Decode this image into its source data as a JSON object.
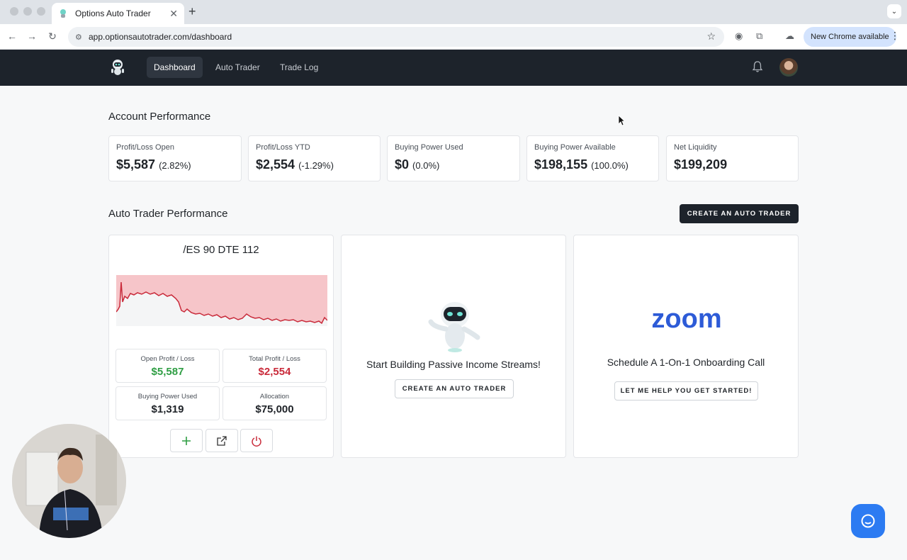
{
  "browser": {
    "tab_title": "Options Auto Trader",
    "url": "app.optionsautotrader.com/dashboard",
    "update_label": "New Chrome available"
  },
  "nav": {
    "items": [
      {
        "label": "Dashboard",
        "active": true
      },
      {
        "label": "Auto Trader",
        "active": false
      },
      {
        "label": "Trade Log",
        "active": false
      }
    ]
  },
  "account": {
    "title": "Account Performance",
    "metrics": [
      {
        "label": "Profit/Loss Open",
        "value": "$5,587",
        "pct": "(2.82%)",
        "tone": "green"
      },
      {
        "label": "Profit/Loss YTD",
        "value": "$2,554",
        "pct": "(-1.29%)",
        "tone": "red"
      },
      {
        "label": "Buying Power Used",
        "value": "$0",
        "pct": "(0.0%)",
        "tone": "neutral"
      },
      {
        "label": "Buying Power Available",
        "value": "$198,155",
        "pct": "(100.0%)",
        "tone": "neutral"
      },
      {
        "label": "Net Liquidity",
        "value": "$199,209",
        "pct": "",
        "tone": "neutral"
      }
    ]
  },
  "auto_trader": {
    "title": "Auto Trader Performance",
    "create_label": "CREATE AN AUTO TRADER",
    "trader": {
      "name": "/ES 90 DTE 112",
      "stats": [
        {
          "label": "Open Profit / Loss",
          "value": "$5,587",
          "tone": "green"
        },
        {
          "label": "Total Profit / Loss",
          "value": "$2,554",
          "tone": "red"
        },
        {
          "label": "Buying Power Used",
          "value": "$1,319",
          "tone": "neutral"
        },
        {
          "label": "Allocation",
          "value": "$75,000",
          "tone": "neutral"
        }
      ]
    },
    "promo": {
      "caption": "Start Building Passive Income Streams!",
      "button": "CREATE AN AUTO TRADER"
    },
    "onboarding": {
      "caption": "Schedule A 1-On-1 Onboarding Call",
      "button": "LET ME HELP YOU GET STARTED!",
      "logo_text": "zoom"
    }
  },
  "colors": {
    "profit": "#2f9e44",
    "loss": "#c92a3a",
    "nav_bg": "#1d232b",
    "chart_fill": "#f6c5c9",
    "chart_line": "#c92a3a",
    "zoom_blue": "#2d5bd7",
    "chat_blue": "#2c7bf2"
  }
}
